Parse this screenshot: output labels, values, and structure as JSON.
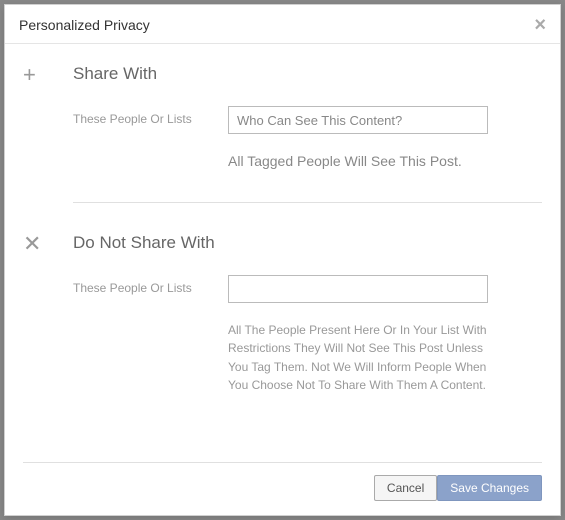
{
  "dialog": {
    "title": "Personalized Privacy",
    "close": "×"
  },
  "share": {
    "icon": "+",
    "heading": "Share With",
    "row_label": "These People Or Lists",
    "placeholder": "Who Can See This Content?",
    "helper": "All Tagged People Will See This Post."
  },
  "exclude": {
    "icon": "✕",
    "heading": "Do Not Share With",
    "row_label": "These People Or Lists",
    "placeholder": "",
    "helper": "All The People Present Here Or In Your List With Restrictions They Will Not See This Post Unless You Tag Them. Not We Will Inform People When You Choose Not To Share With Them A Content."
  },
  "footer": {
    "cancel": "Cancel",
    "save": "Save Changes"
  }
}
